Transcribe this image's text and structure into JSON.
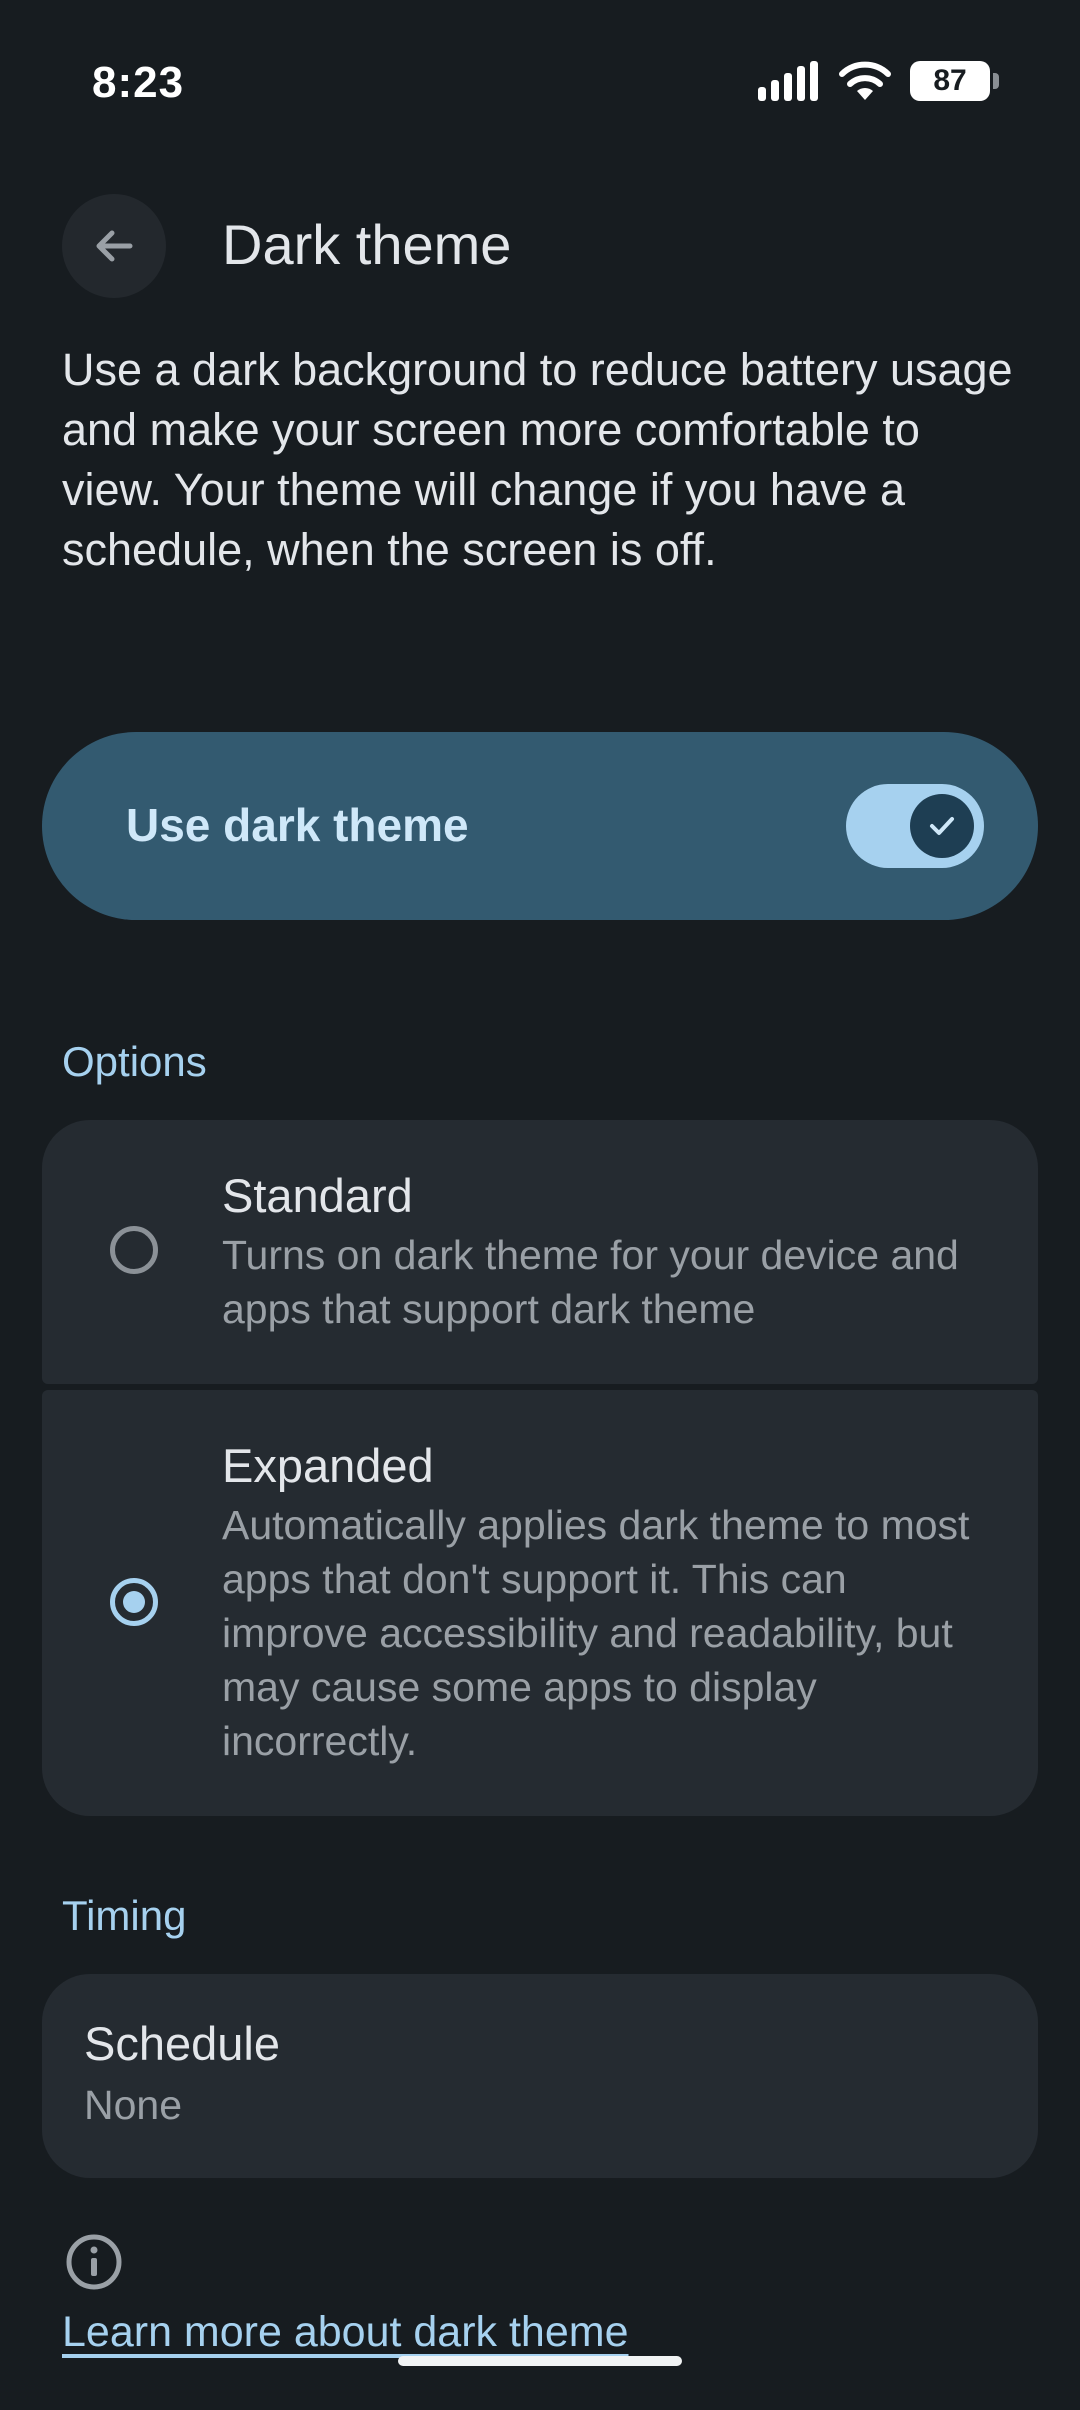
{
  "status_bar": {
    "time": "8:23",
    "battery_level": "87",
    "signal_icon": "cellular-signal-icon",
    "wifi_icon": "wifi-icon"
  },
  "header": {
    "title": "Dark theme",
    "back_icon": "arrow-back-icon"
  },
  "description": "Use a dark background to reduce battery usage and make your screen more comfortable to view. Your theme will change if you have a schedule, when the screen is off.",
  "main_toggle": {
    "label": "Use dark theme",
    "enabled": true
  },
  "options": {
    "section_label": "Options",
    "items": [
      {
        "title": "Standard",
        "subtitle": "Turns on dark theme for your device and apps that support dark theme",
        "selected": false
      },
      {
        "title": "Expanded",
        "subtitle": "Automatically applies dark theme to most apps that don't support it. This can improve accessibility and readability, but may cause some apps to display incorrectly.",
        "selected": true
      }
    ]
  },
  "timing": {
    "section_label": "Timing",
    "schedule_title": "Schedule",
    "schedule_value": "None"
  },
  "footer": {
    "info_icon": "info-icon",
    "learn_more_link": "Learn more about dark theme"
  },
  "colors": {
    "background": "#171c20",
    "accent": "#a6d1ef",
    "toggle_container": "#335a70",
    "card": "#252b31"
  }
}
